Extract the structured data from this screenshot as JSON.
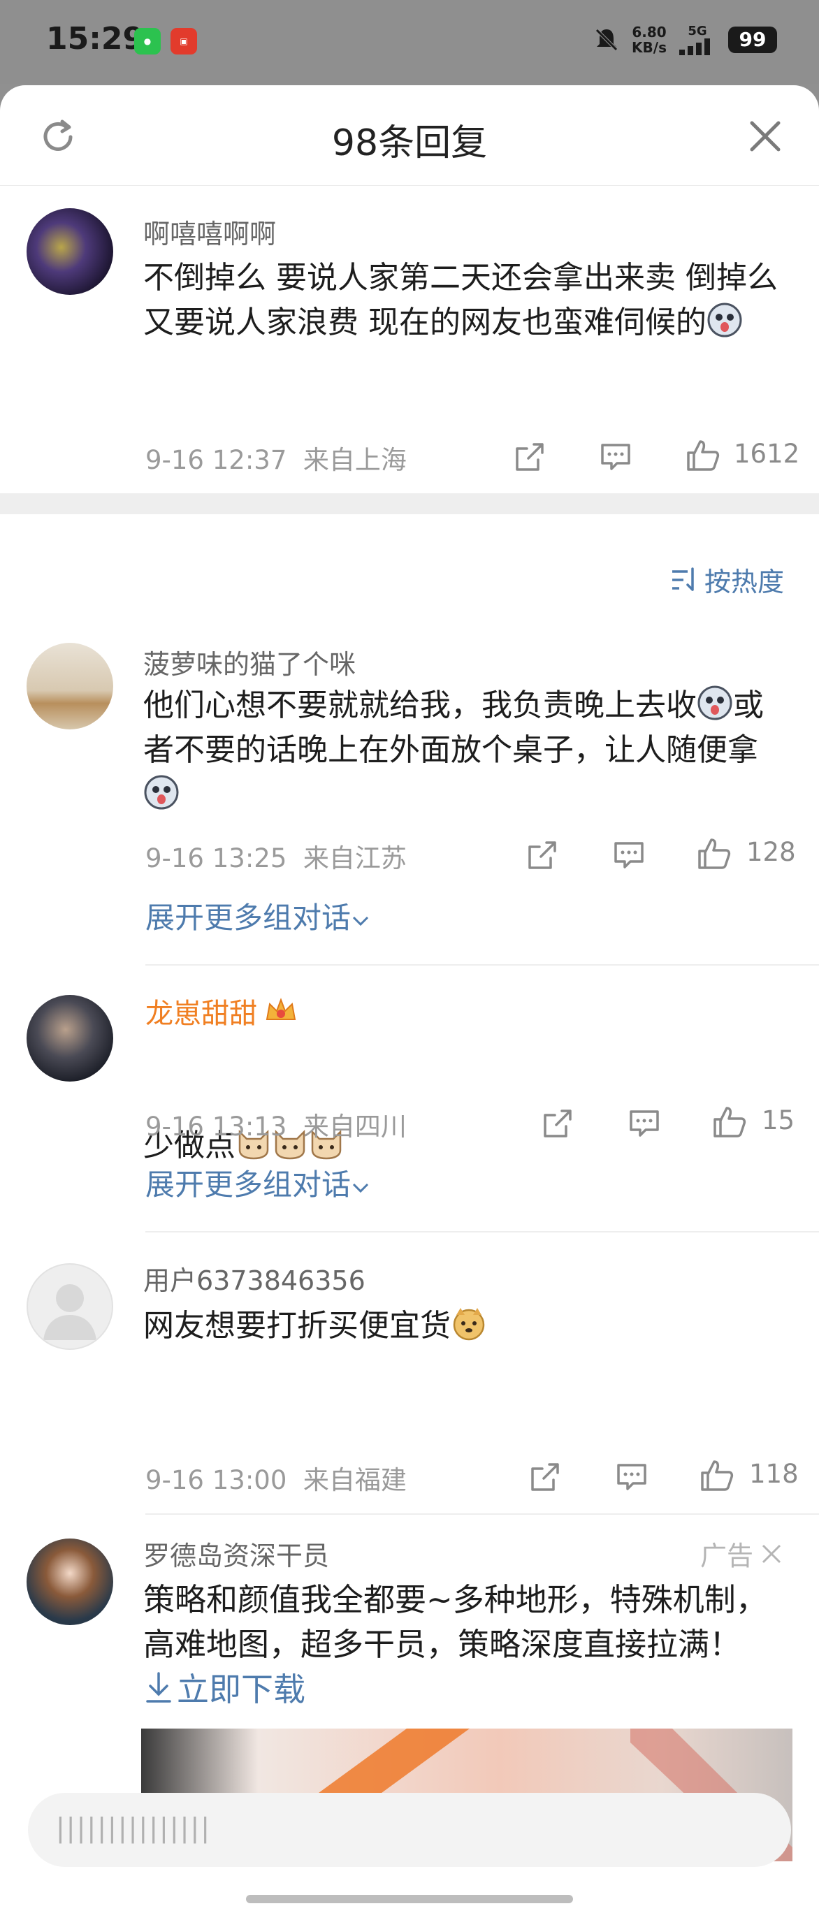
{
  "status_bar": {
    "time": "15:29",
    "net_speed_value": "6.80",
    "net_speed_unit": "KB/s",
    "network": "5G",
    "battery": "99",
    "app_icons": [
      "wechat-icon",
      "news-app-icon"
    ]
  },
  "header": {
    "title": "98条回复",
    "refresh_icon": "refresh-icon",
    "close_icon": "close-icon"
  },
  "root_comment": {
    "username": "啊嘻嘻啊啊",
    "text": "不倒掉么 要说人家第二天还会拿出来卖 倒掉么 又要说人家浪费 现在的网友也蛮难伺候的",
    "time": "9-16 12:37",
    "location": "来自上海",
    "likes": "1612"
  },
  "sort": {
    "label": "按热度"
  },
  "replies": [
    {
      "username": "菠萝味的猫了个咪",
      "text_a": "他们心想不要就就给我，我负责晚上去收",
      "text_b": "或者不要的话晚上在外面放个桌子，让人随便拿",
      "time": "9-16 13:25",
      "location": "来自江苏",
      "likes": "128",
      "expand": "展开更多组对话"
    },
    {
      "username": "龙崽甜甜",
      "text": "少做点",
      "time": "9-16 13:13",
      "location": "来自四川",
      "likes": "15",
      "expand": "展开更多组对话"
    },
    {
      "username": "用户6373846356",
      "text": "网友想要打折买便宜货",
      "time": "9-16 13:00",
      "location": "来自福建",
      "likes": "118"
    }
  ],
  "ad": {
    "username": "罗德岛资深干员",
    "label": "广告",
    "text": "策略和颜值我全都要~多种地形，特殊机制，高难地图，超多干员，策略深度直接拉满！",
    "download": "立即下载"
  },
  "input": {
    "placeholder": "|||||||||||||||"
  },
  "colors": {
    "link": "#4e7bad",
    "vip_name": "#f07f22",
    "meta": "#9a9a9a"
  }
}
